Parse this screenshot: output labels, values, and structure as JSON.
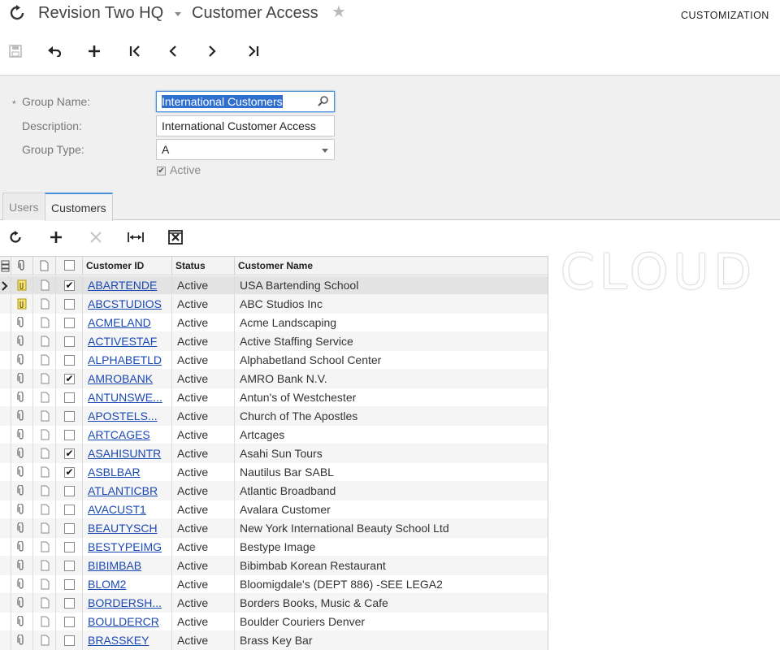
{
  "header": {
    "company": "Revision Two HQ",
    "screen_title": "Customer Access",
    "customization_label": "CUSTOMIZATION"
  },
  "toolbar": {
    "icons": [
      "save-icon",
      "undo-icon",
      "add-icon",
      "first-record-icon",
      "previous-record-icon",
      "next-record-icon",
      "last-record-icon"
    ]
  },
  "form": {
    "group_name_label": "Group Name:",
    "group_name_value": "International Customers",
    "description_label": "Description:",
    "description_value": "International Customer Access",
    "group_type_label": "Group Type:",
    "group_type_value": "A",
    "active_label": "Active",
    "active_checked": true
  },
  "tabs": [
    {
      "label": "Users",
      "active": false
    },
    {
      "label": "Customers",
      "active": true
    }
  ],
  "grid_toolbar": {
    "icons": [
      "refresh-icon",
      "add-row-icon",
      "delete-row-icon",
      "fit-columns-icon",
      "export-excel-icon"
    ]
  },
  "grid": {
    "columns": [
      "Customer ID",
      "Status",
      "Customer Name"
    ],
    "rows": [
      {
        "included": true,
        "id": "ABARTENDE",
        "status": "Active",
        "name": "USA Bartending School",
        "has_file": true
      },
      {
        "included": false,
        "id": "ABCSTUDIOS",
        "status": "Active",
        "name": "ABC Studios Inc",
        "has_file": true
      },
      {
        "included": false,
        "id": "ACMELAND",
        "status": "Active",
        "name": "Acme Landscaping",
        "has_file": false
      },
      {
        "included": false,
        "id": "ACTIVESTAF",
        "status": "Active",
        "name": "Active Staffing Service",
        "has_file": false
      },
      {
        "included": false,
        "id": "ALPHABETLD",
        "status": "Active",
        "name": "Alphabetland School Center",
        "has_file": false
      },
      {
        "included": true,
        "id": "AMROBANK",
        "status": "Active",
        "name": "AMRO Bank N.V.",
        "has_file": false
      },
      {
        "included": false,
        "id": "ANTUNSWE...",
        "status": "Active",
        "name": "Antun's of Westchester",
        "has_file": false
      },
      {
        "included": false,
        "id": "APOSTELS...",
        "status": "Active",
        "name": "Church of The Apostles",
        "has_file": false
      },
      {
        "included": false,
        "id": "ARTCAGES",
        "status": "Active",
        "name": "Artcages",
        "has_file": false
      },
      {
        "included": true,
        "id": "ASAHISUNTR",
        "status": "Active",
        "name": "Asahi Sun Tours",
        "has_file": false
      },
      {
        "included": true,
        "id": "ASBLBAR",
        "status": "Active",
        "name": "Nautilus Bar SABL",
        "has_file": false
      },
      {
        "included": false,
        "id": "ATLANTICBR",
        "status": "Active",
        "name": "Atlantic Broadband",
        "has_file": false
      },
      {
        "included": false,
        "id": "AVACUST1",
        "status": "Active",
        "name": "Avalara Customer",
        "has_file": false
      },
      {
        "included": false,
        "id": "BEAUTYSCH",
        "status": "Active",
        "name": "New York International Beauty School Ltd",
        "has_file": false
      },
      {
        "included": false,
        "id": "BESTYPEIMG",
        "status": "Active",
        "name": "Bestype Image",
        "has_file": false
      },
      {
        "included": false,
        "id": "BIBIMBAB",
        "status": "Active",
        "name": "Bibimbab Korean Restaurant",
        "has_file": false
      },
      {
        "included": false,
        "id": "BLOM2",
        "status": "Active",
        "name": "Bloomigdale's (DEPT 886) -SEE LEGA2",
        "has_file": false
      },
      {
        "included": false,
        "id": "BORDERSH...",
        "status": "Active",
        "name": "Borders Books, Music & Cafe",
        "has_file": false
      },
      {
        "included": false,
        "id": "BOULDERCR",
        "status": "Active",
        "name": "Boulder Couriers Denver",
        "has_file": false
      },
      {
        "included": false,
        "id": "BRASSKEY",
        "status": "Active",
        "name": "Brass Key Bar",
        "has_file": false
      }
    ]
  },
  "watermark": "CLOUD"
}
